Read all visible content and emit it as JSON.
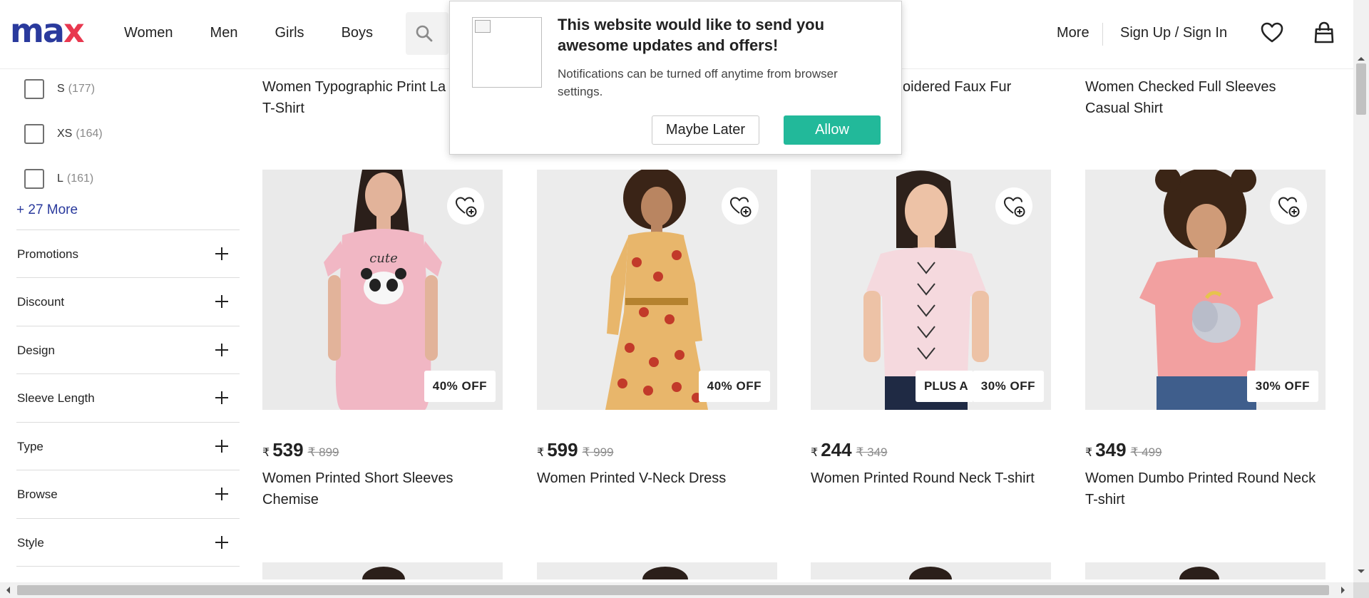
{
  "header": {
    "logo": "max",
    "nav": [
      "Women",
      "Men",
      "Girls",
      "Boys"
    ],
    "more_label": "More",
    "sign_in_label": "Sign Up / Sign In"
  },
  "sidebar": {
    "sizes": [
      {
        "label": "S",
        "count": "(177)"
      },
      {
        "label": "XS",
        "count": "(164)"
      },
      {
        "label": "L",
        "count": "(161)"
      }
    ],
    "more_link": "+ 27 More",
    "filters": [
      "Promotions",
      "Discount",
      "Design",
      "Sleeve Length",
      "Type",
      "Browse",
      "Style"
    ]
  },
  "top_row": {
    "names": [
      "Women Typographic Print La",
      "T-Shirt",
      "oidered Faux Fur",
      "Women Checked Full Sleeves",
      "Casual Shirt"
    ]
  },
  "products": [
    {
      "name": "Women Printed Short Sleeves Chemise",
      "currency": "₹",
      "price": "539",
      "mrp": "₹ 899",
      "discount": "40% OFF",
      "plus_badge": ""
    },
    {
      "name": "Women Printed V-Neck Dress",
      "currency": "₹",
      "price": "599",
      "mrp": "₹ 999",
      "discount": "40% OFF",
      "plus_badge": ""
    },
    {
      "name": "Women Printed Round Neck T-shirt",
      "currency": "₹",
      "price": "244",
      "mrp": "₹ 349",
      "discount": "30% OFF",
      "plus_badge": "PLUS A"
    },
    {
      "name": "Women Dumbo Printed Round Neck T-shirt",
      "currency": "₹",
      "price": "349",
      "mrp": "₹ 499",
      "discount": "30% OFF",
      "plus_badge": ""
    }
  ],
  "popup": {
    "title": "This website would like to send you awesome updates and offers!",
    "description": "Notifications can be turned off anytime from browser settings.",
    "later_label": "Maybe Later",
    "allow_label": "Allow"
  },
  "colors": {
    "brand_blue": "#2a3a9d",
    "brand_red": "#e8384f",
    "allow_green": "#22b99a"
  },
  "icons": [
    "search-icon",
    "heart-icon",
    "bag-icon",
    "plus-icon",
    "wishlist-add-icon",
    "broken-image-icon"
  ]
}
